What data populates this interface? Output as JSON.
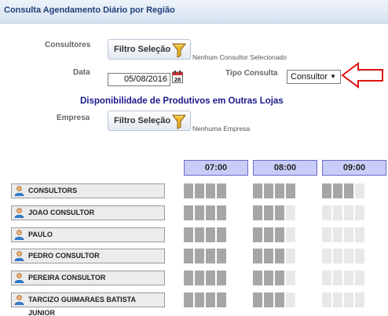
{
  "header": {
    "title": "Consulta Agendamento Diário por Região"
  },
  "form": {
    "consultores_label": "Consultores",
    "consultores_button": "Filtro Seleção",
    "consultores_hint": "Nenhum Consultor Selecionado",
    "data_label": "Data",
    "data_value": "05/08/2016",
    "calendar_day": "28",
    "tipo_consulta_label": "Tipo Consulta",
    "tipo_consulta_value": "Consultor",
    "section_heading": "Disponibilidade de Produtivos em Outras Lojas",
    "empresa_label": "Empresa",
    "empresa_button": "Filtro Seleção",
    "empresa_hint": "Nenhuma Empresa"
  },
  "schedule": {
    "hours": [
      "07:00",
      "08:00",
      "09:00"
    ],
    "consultants": [
      {
        "name": "CONSULTORS",
        "busy_slots": 11
      },
      {
        "name": "JOAO CONSULTOR",
        "busy_slots": 7
      },
      {
        "name": "PAULO",
        "busy_slots": 7
      },
      {
        "name": "PEDRO CONSULTOR",
        "busy_slots": 7
      },
      {
        "name": "PEREIRA CONSULTOR",
        "busy_slots": 7
      },
      {
        "name": "TARCIZO GUIMARAES BATISTA JUNIOR",
        "busy_slots": 7
      }
    ]
  },
  "colors": {
    "title_text": "#1f3f7a",
    "heading_text": "#1a1a8c",
    "time_header_bg": "#c9ccf7",
    "slot_busy": "#a6a6a6",
    "slot_free": "#e8e8e8",
    "annotation_arrow": "#e01010"
  },
  "icons": {
    "filter": "funnel-icon",
    "calendar": "calendar-icon",
    "consultant": "person-icon",
    "annotation": "red-arrow-icon"
  }
}
